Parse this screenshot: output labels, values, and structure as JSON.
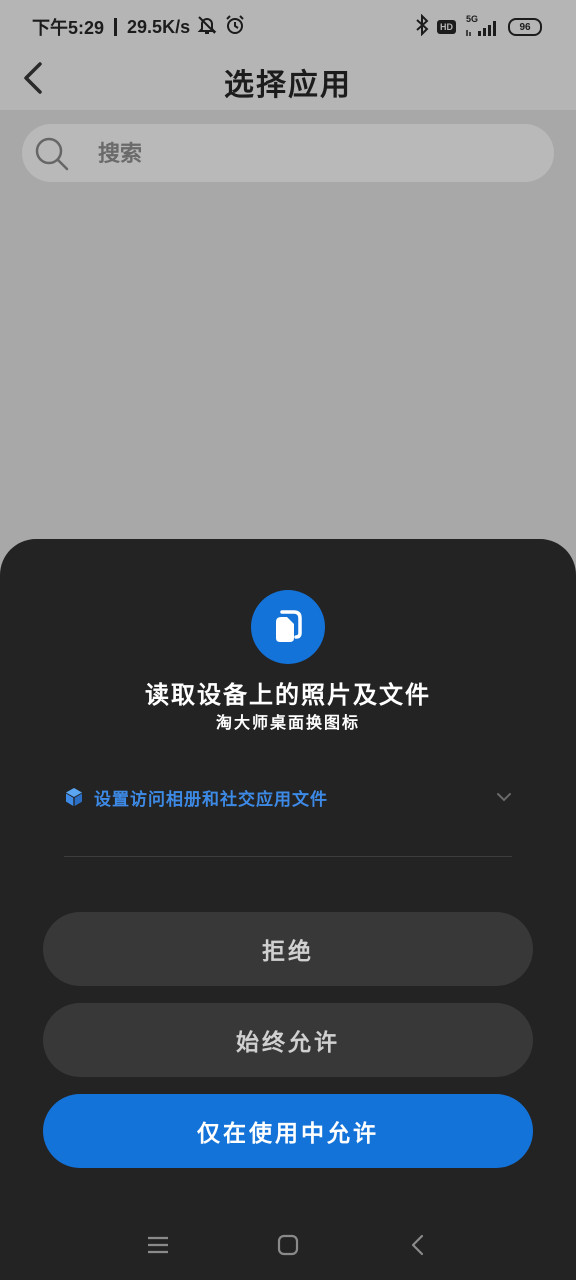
{
  "status_bar": {
    "time": "下午5:29",
    "net_speed": "29.5K/s",
    "hd_label": "HD",
    "network_type": "5G",
    "battery": "96",
    "icons": [
      "mute-icon",
      "alarm-icon",
      "bluetooth-icon",
      "signal-icon"
    ]
  },
  "header": {
    "title": "选择应用",
    "back_icon": "back-arrow-icon"
  },
  "search": {
    "placeholder": "搜索",
    "icon": "search-icon"
  },
  "permission_sheet": {
    "icon": "files-icon",
    "title": "读取设备上的照片及文件",
    "app_name": "淘大师桌面换图标",
    "settings_link": "设置访问相册和社交应用文件",
    "buttons": {
      "deny": "拒绝",
      "always_allow": "始终允许",
      "allow_while_using": "仅在使用中允许"
    }
  },
  "nav_bar": {
    "icons": [
      "menu-icon",
      "home-icon",
      "back-icon"
    ]
  },
  "colors": {
    "accent": "#1473d9",
    "link": "#3d8ae6",
    "sheet_bg": "#232323",
    "button_bg": "#383838",
    "overlay_bg": "#a8a8a8"
  }
}
